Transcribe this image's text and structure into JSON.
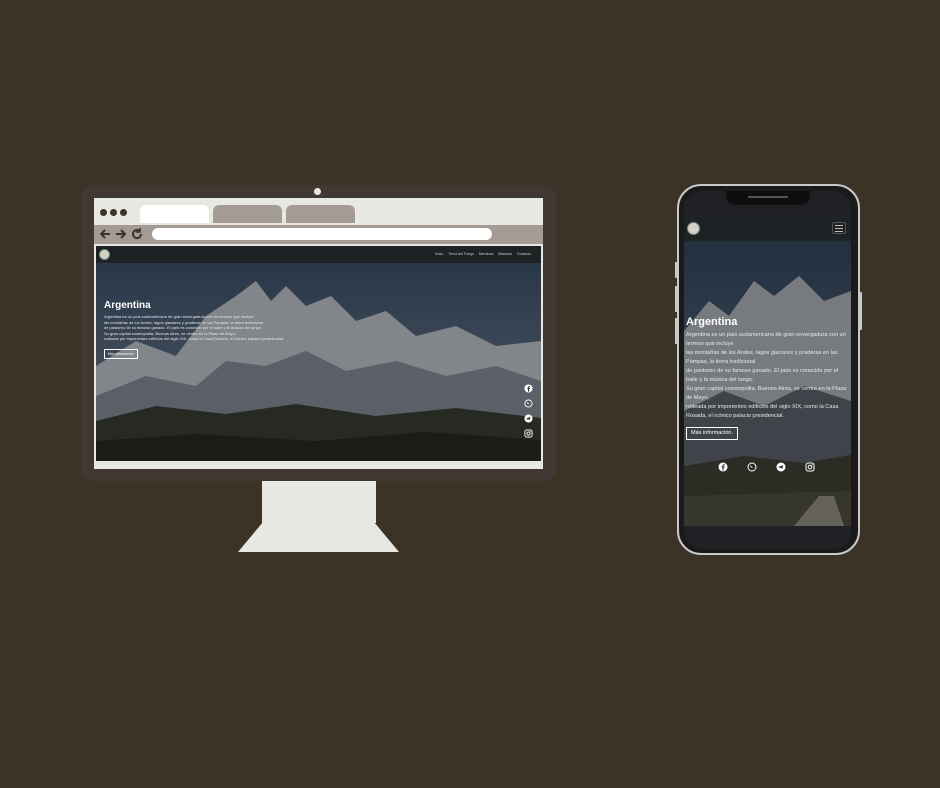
{
  "browser": {
    "back_icon": "arrow-left-icon",
    "forward_icon": "arrow-right-icon",
    "reload_icon": "reload-icon",
    "url": ""
  },
  "site": {
    "nav": [
      "Inicio",
      "Tierra del Fuego",
      "Mendoza",
      "Misiones",
      "Contacto"
    ],
    "title": "Argentina",
    "body": "Argentina es un país sudamericano de gran envergadura con un terreno que incluye\nlas montañas de los Andes, lagos glaciares y praderas en las Pampas, la tierra tradicional\nde pastoreo de su famoso ganado. El país es conocido por el baile y la música del tango.\nSu gran capital cosmopolita, Buenos Aires, se centra en la Plaza de Mayo,\nrodeada por imponentes edificios del siglo XIX, como la Casa Rosada, el icónico palacio presidencial.",
    "button": "Más información",
    "social_icons": [
      "facebook-icon",
      "whatsapp-icon",
      "telegram-icon",
      "instagram-icon"
    ]
  },
  "mobile": {
    "title": "Argentina",
    "body": "Argentina es un país sudamericano de gran envergadura con un terreno que incluye\nlas montañas de los Andes, lagos glaciares y praderas en las Pampas, la tierra tradicional\nde pastoreo de su famoso ganado. El país es conocido por el baile y la música del tango.\nSu gran capital cosmopolita, Buenos Aires, se centra en la Plaza de Mayo,\nrodeada por imponentes edificios del siglo XIX, como la Casa Rosada, el icónico palacio presidencial.",
    "button": "Más información.",
    "menu_icon": "hamburger-menu-icon"
  },
  "colors": {
    "background": "#3a3326",
    "monitor_frame": "#413834",
    "browser_chrome": "#e8e8e2",
    "inactive_tab": "#a59b95",
    "site_header": "#1f2225"
  }
}
